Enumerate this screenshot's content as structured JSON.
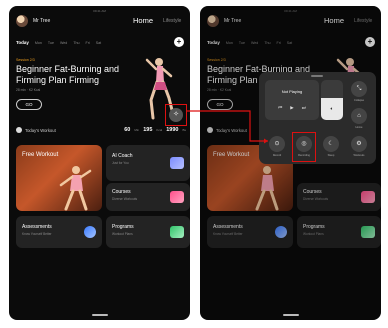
{
  "left": {
    "status_time": "09:41 AM",
    "user": {
      "name": "Mr Tree"
    },
    "tabs": {
      "home": "Home",
      "lifestyle": "Lifestyle"
    },
    "days": [
      "Today",
      "Mon",
      "Tue",
      "Wed",
      "Thu",
      "Fri",
      "Sat"
    ],
    "add_label": "+",
    "hero": {
      "session": "Session 2/3",
      "title": "Beginner Fat-Burning and Firming Plan Firming",
      "meta": "28 min  ·  K2 Kcal",
      "go_label": "GO"
    },
    "workout": {
      "label": "Today's Workout",
      "minutes": "60",
      "minutes_unit": "Min",
      "kcal": "195",
      "kcal_unit": "Kcal",
      "steps": "1990",
      "steps_unit": "Bs"
    },
    "cards": {
      "free_workout": "Free Workout",
      "ai_coach": {
        "title": "AI Coach",
        "subtitle": "Just for You"
      },
      "courses": {
        "title": "Courses",
        "subtitle": "Diverse Workouts"
      },
      "assessments": {
        "title": "Assessments",
        "subtitle": "Know Yourself Better"
      },
      "programs": {
        "title": "Programs",
        "subtitle": "Workout Plans"
      }
    },
    "fab_icon": "sparkle-icon"
  },
  "right": {
    "status_time": "09:41 AM",
    "user": {
      "name": "Mr Tree"
    },
    "tabs": {
      "home": "Home",
      "lifestyle": "Lifestyle"
    },
    "days": [
      "Today",
      "Mon",
      "Tue",
      "Wed",
      "Thu",
      "Fri",
      "Sat"
    ],
    "hero": {
      "session": "Session 2/3",
      "title": "Beginner Fat-Burning and Firming Plan",
      "meta": "28 min  ·  K2 Kcal",
      "go_label": "GO"
    },
    "workout": {
      "label": "Today's Workout"
    },
    "cards": {
      "free_workout": "Free Workout",
      "courses": {
        "title": "Courses",
        "subtitle": "Diverse Workouts"
      },
      "assessments": {
        "title": "Assessments",
        "subtitle": "Know Yourself Better"
      },
      "programs": {
        "title": "Programs",
        "subtitle": "Workout Plans"
      }
    },
    "panel": {
      "now_playing": "Not Playing",
      "volume_level": 0.55,
      "buttons": {
        "collapse": "Collapse",
        "home": "Home",
        "record": "Record",
        "recording": "Recording",
        "sleep": "Sleep",
        "workouts": "Workouts"
      }
    }
  },
  "colors": {
    "highlight": "#dd1111",
    "accent": "#f0a020",
    "background": "#0b0b0b"
  }
}
